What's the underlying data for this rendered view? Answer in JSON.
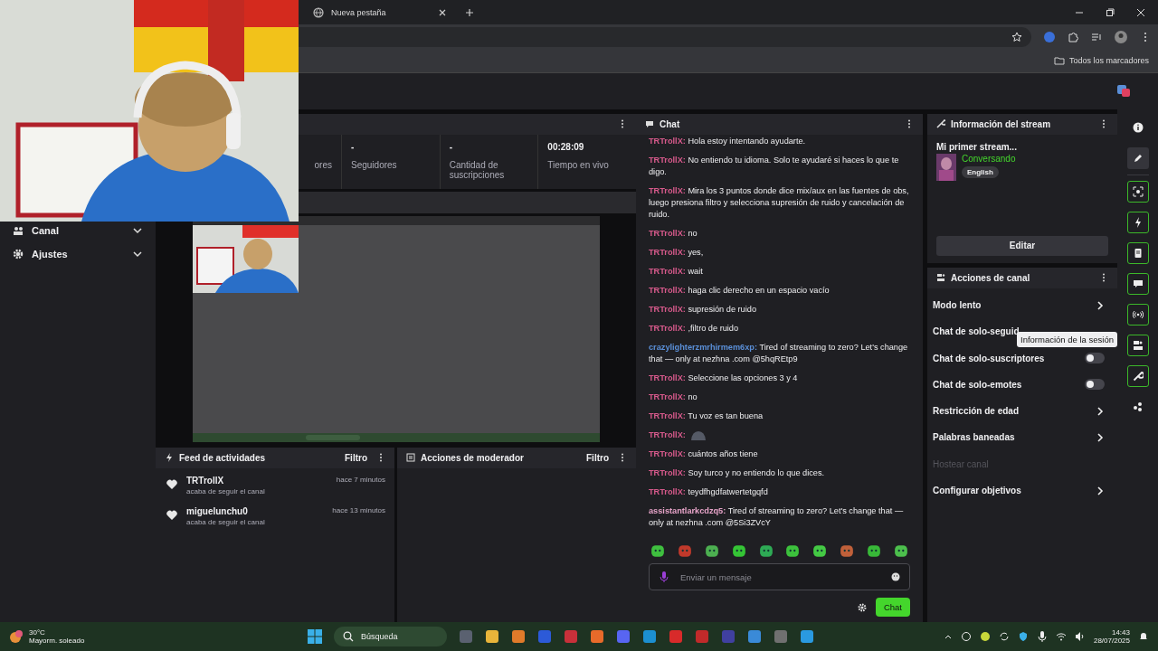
{
  "browser": {
    "tab_title": "Nueva pestaña",
    "bookmarks_folder": "Todos los marcadores"
  },
  "sidebar": {
    "items": [
      {
        "label": "Canal",
        "expanded": false
      },
      {
        "label": "Ajustes",
        "expanded": false
      }
    ]
  },
  "stats": [
    {
      "label": "ores"
    },
    {
      "value": "-",
      "label": "Seguidores"
    },
    {
      "value": "-",
      "label": "Cantidad de suscripciones"
    },
    {
      "value": "00:28:09",
      "label": "Tiempo en vivo"
    }
  ],
  "activity_feed": {
    "title": "Feed de actividades",
    "filter": "Filtro",
    "events": [
      {
        "user": "TRTrollX",
        "action": "acaba de seguir el canal",
        "time": "hace 7 minutos"
      },
      {
        "user": "miguelunchu0",
        "action": "acaba de seguir el canal",
        "time": "hace 13 minutos"
      }
    ]
  },
  "mod_actions": {
    "title": "Acciones de moderador",
    "filter": "Filtro"
  },
  "chat": {
    "title": "Chat",
    "messages": [
      {
        "kind": "text",
        "user": "TRTrollX:",
        "color": "#d85a8c",
        "text": "Hola estoy intentando ayudarte."
      },
      {
        "kind": "text",
        "user": "TRTrollX:",
        "color": "#d85a8c",
        "text": "No entiendo tu idioma. Solo te ayudaré si haces lo que te digo."
      },
      {
        "kind": "text",
        "user": "TRTrollX:",
        "color": "#d85a8c",
        "text": "Mira los 3 puntos donde dice mix/aux en las fuentes de obs, luego presiona filtro y selecciona supresión de ruido y cancelación de ruido."
      },
      {
        "kind": "text",
        "user": "TRTrollX:",
        "color": "#d85a8c",
        "text": "no"
      },
      {
        "kind": "text",
        "user": "TRTrollX:",
        "color": "#d85a8c",
        "text": "yes,"
      },
      {
        "kind": "text",
        "user": "TRTrollX:",
        "color": "#d85a8c",
        "text": "wait"
      },
      {
        "kind": "text",
        "user": "TRTrollX:",
        "color": "#d85a8c",
        "text": "haga clic derecho en un espacio vacío"
      },
      {
        "kind": "text",
        "user": "TRTrollX:",
        "color": "#d85a8c",
        "text": "supresión de ruido"
      },
      {
        "kind": "text",
        "user": "TRTrollX:",
        "color": "#d85a8c",
        "text": ",filtro de ruido"
      },
      {
        "kind": "text",
        "user": "crazylighterzmrhirmem6xp:",
        "color": "#5a8fd8",
        "text": "Tired of streaming to zero? Let's change that — only at nezhna .com @5hqREtp9"
      },
      {
        "kind": "text",
        "user": "TRTrollX:",
        "color": "#d85a8c",
        "text": "Seleccione las opciones 3 y 4"
      },
      {
        "kind": "text",
        "user": "TRTrollX:",
        "color": "#d85a8c",
        "text": "no"
      },
      {
        "kind": "text",
        "user": "TRTrollX:",
        "color": "#d85a8c",
        "text": "Tu voz es tan buena"
      },
      {
        "kind": "emote",
        "user": "TRTrollX:",
        "color": "#d85a8c"
      },
      {
        "kind": "text",
        "user": "TRTrollX:",
        "color": "#d85a8c",
        "text": "cuántos años tiene"
      },
      {
        "kind": "text",
        "user": "TRTrollX:",
        "color": "#d85a8c",
        "text": "Soy turco y no entiendo lo que dices."
      },
      {
        "kind": "text",
        "user": "TRTrollX:",
        "color": "#d85a8c",
        "text": "teydfhgdfatwertetgqfd"
      },
      {
        "kind": "text",
        "user": "assistantlarkcdzq5:",
        "color": "#e6a3c8",
        "text": "Tired of streaming to zero? Let's change that — only at nezhna .com @5Si3ZVcY"
      }
    ],
    "placeholder": "Enviar un mensaje",
    "send": "Chat"
  },
  "stream_info": {
    "title": "Información del stream",
    "stream_title": "Mi primer stream...",
    "category": "Conversando",
    "tag": "English",
    "edit": "Editar"
  },
  "channel_actions": {
    "title": "Acciones de canal",
    "items": [
      {
        "kind": "link",
        "label": "Modo lento"
      },
      {
        "kind": "plain",
        "label": "Chat de solo-seguid"
      },
      {
        "kind": "toggle",
        "label": "Chat de solo-suscriptores",
        "on": false
      },
      {
        "kind": "toggle",
        "label": "Chat de solo-emotes",
        "on": false
      },
      {
        "kind": "link",
        "label": "Restricción de edad"
      },
      {
        "kind": "link",
        "label": "Palabras baneadas"
      },
      {
        "kind": "disabled",
        "label": "Hostear canal"
      },
      {
        "kind": "link",
        "label": "Configurar objetivos"
      }
    ]
  },
  "rail": [
    {
      "kind": "info",
      "selected": false
    },
    {
      "kind": "pencil",
      "selected": true
    },
    {
      "kind": "capture",
      "selected": false
    },
    {
      "kind": "bolt",
      "selected": false
    },
    {
      "kind": "note",
      "selected": false
    },
    {
      "kind": "chat",
      "selected": false
    },
    {
      "kind": "broadcast",
      "selected": false
    },
    {
      "kind": "stage",
      "selected": false
    },
    {
      "kind": "wrench",
      "selected": false
    },
    {
      "kind": "dots",
      "selected": false
    }
  ],
  "tooltip": "Información de la sesión",
  "taskbar": {
    "temperature": "30°C",
    "weather": "Mayorm. soleado",
    "search": {
      "placeholder": "Búsqueda"
    },
    "time": "14:43",
    "date": "28/07/2025"
  }
}
